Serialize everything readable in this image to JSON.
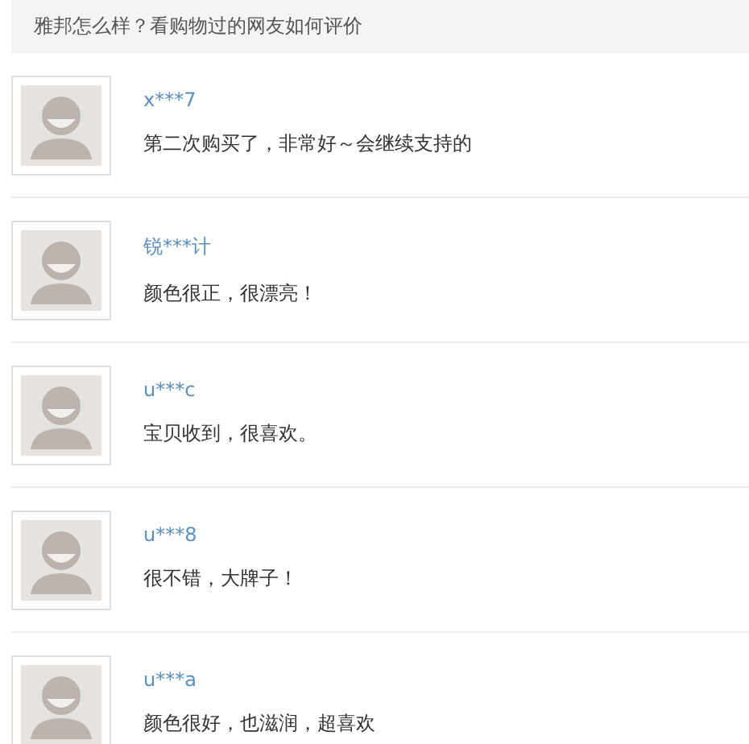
{
  "header": {
    "title": "雅邦怎么样？看购物过的网友如何评价"
  },
  "reviews": [
    {
      "user": "x***7",
      "comment": "第二次购买了，非常好～会继续支持的"
    },
    {
      "user": "锐***计",
      "comment": "颜色很正，很漂亮！"
    },
    {
      "user": "u***c",
      "comment": "宝贝收到，很喜欢。"
    },
    {
      "user": "u***8",
      "comment": "很不错，大牌子！"
    },
    {
      "user": "u***a",
      "comment": "颜色很好，也滋润，超喜欢"
    }
  ]
}
